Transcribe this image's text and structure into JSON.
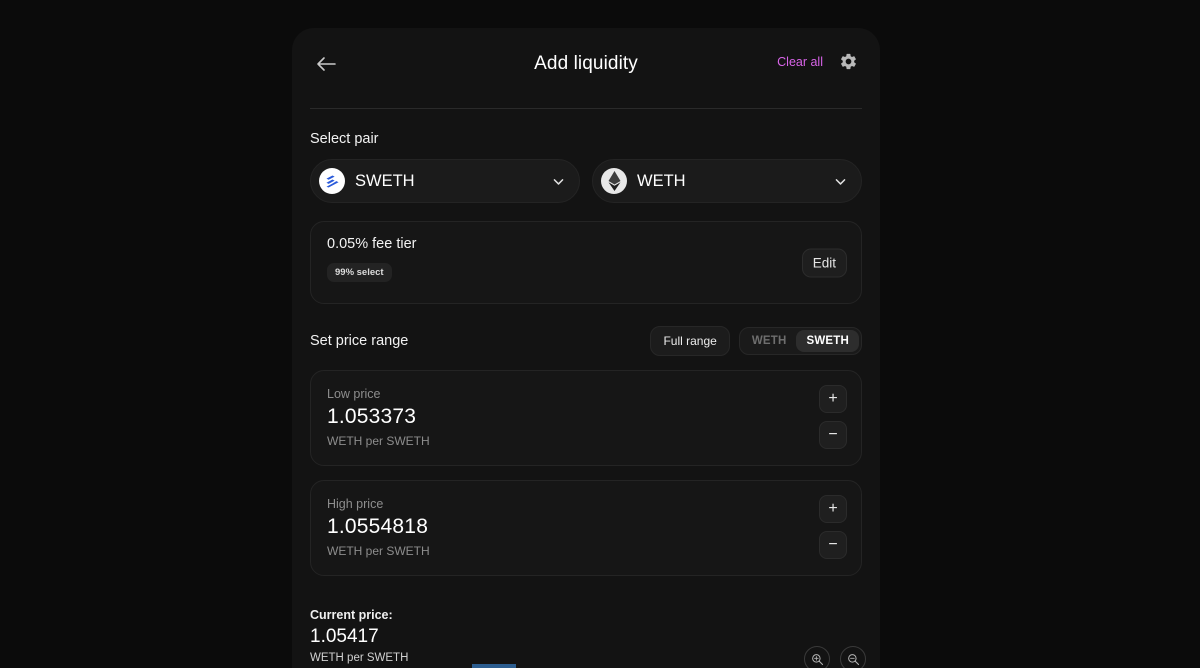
{
  "header": {
    "title": "Add liquidity",
    "back_icon": "arrow-left-icon",
    "clear_all_label": "Clear all",
    "settings_icon": "gear-icon",
    "clear_all_color": "#d864e8"
  },
  "select_pair": {
    "label": "Select pair",
    "tokens": [
      {
        "symbol": "SWETH",
        "icon": "sweth-token-icon",
        "chevron": "chevron-down-icon"
      },
      {
        "symbol": "WETH",
        "icon": "weth-token-icon",
        "chevron": "chevron-down-icon"
      }
    ]
  },
  "fee_tier": {
    "title": "0.05% fee tier",
    "badge": "99% select",
    "edit_label": "Edit"
  },
  "price_range": {
    "label": "Set price range",
    "full_range_label": "Full range",
    "toggle": [
      {
        "label": "WETH",
        "active": false
      },
      {
        "label": "SWETH",
        "active": true
      }
    ],
    "cards": [
      {
        "label": "Low price",
        "value": "1.053373",
        "unit": "WETH per SWETH",
        "increment": "+",
        "decrement": "−"
      },
      {
        "label": "High price",
        "value": "1.0554818",
        "unit": "WETH per SWETH",
        "increment": "+",
        "decrement": "−"
      }
    ]
  },
  "current_price": {
    "label": "Current price:",
    "value": "1.05417",
    "unit": "WETH per SWETH",
    "zoom_in_icon": "zoom-in-icon",
    "zoom_out_icon": "zoom-out-icon"
  }
}
